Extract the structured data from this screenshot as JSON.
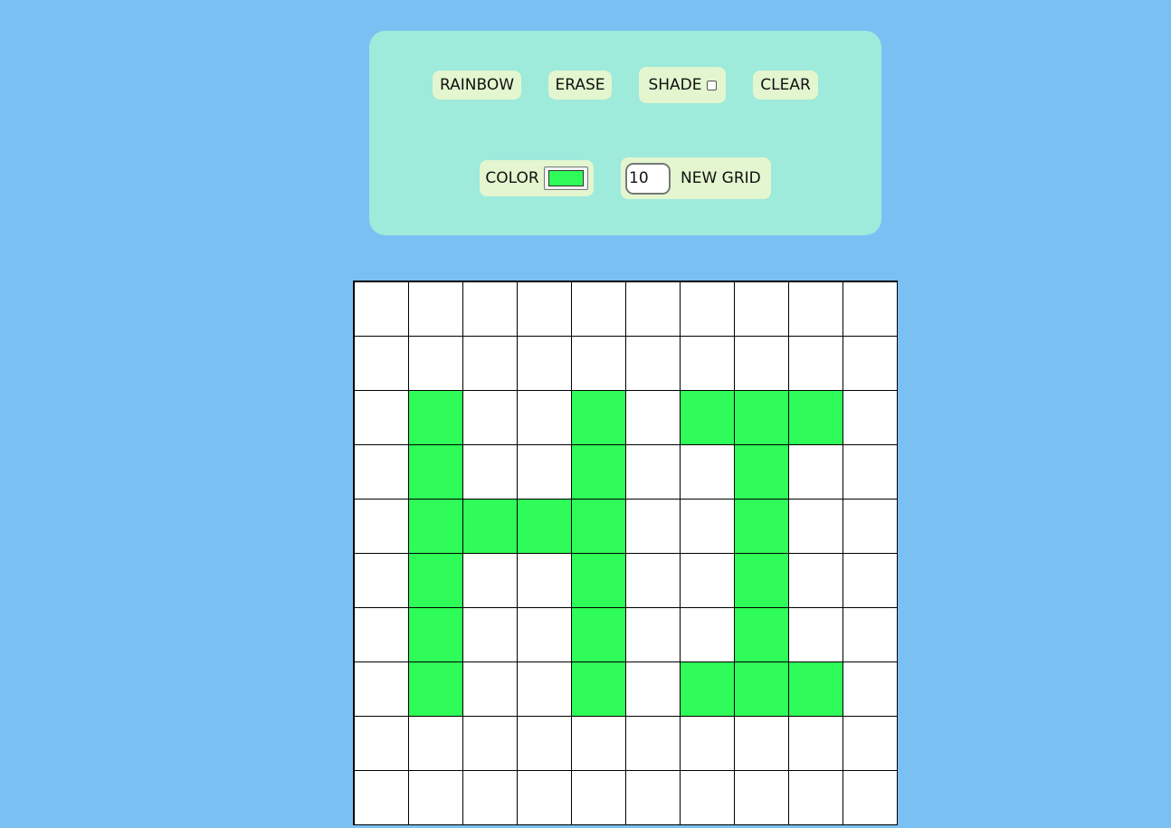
{
  "controls": {
    "rainbow_label": "RAINBOW",
    "erase_label": "ERASE",
    "shade_label": "SHADE",
    "shade_checked": false,
    "clear_label": "CLEAR",
    "color_label": "COLOR",
    "color_value": "#2ffc58",
    "grid_size_value": "10",
    "new_grid_label": "NEW GRID"
  },
  "colors": {
    "page_background": "#7bc0f3",
    "panel_background": "#9eeadb",
    "button_background": "#e3f6cf",
    "cell_empty": "#ffffff",
    "cell_painted": "#2ffc58"
  },
  "grid": {
    "size": 10,
    "cells": [
      [
        0,
        0,
        0,
        0,
        0,
        0,
        0,
        0,
        0,
        0
      ],
      [
        0,
        0,
        0,
        0,
        0,
        0,
        0,
        0,
        0,
        0
      ],
      [
        0,
        1,
        0,
        0,
        1,
        0,
        1,
        1,
        1,
        0
      ],
      [
        0,
        1,
        0,
        0,
        1,
        0,
        0,
        1,
        0,
        0
      ],
      [
        0,
        1,
        1,
        1,
        1,
        0,
        0,
        1,
        0,
        0
      ],
      [
        0,
        1,
        0,
        0,
        1,
        0,
        0,
        1,
        0,
        0
      ],
      [
        0,
        1,
        0,
        0,
        1,
        0,
        0,
        1,
        0,
        0
      ],
      [
        0,
        1,
        0,
        0,
        1,
        0,
        1,
        1,
        1,
        0
      ],
      [
        0,
        0,
        0,
        0,
        0,
        0,
        0,
        0,
        0,
        0
      ],
      [
        0,
        0,
        0,
        0,
        0,
        0,
        0,
        0,
        0,
        0
      ]
    ]
  }
}
